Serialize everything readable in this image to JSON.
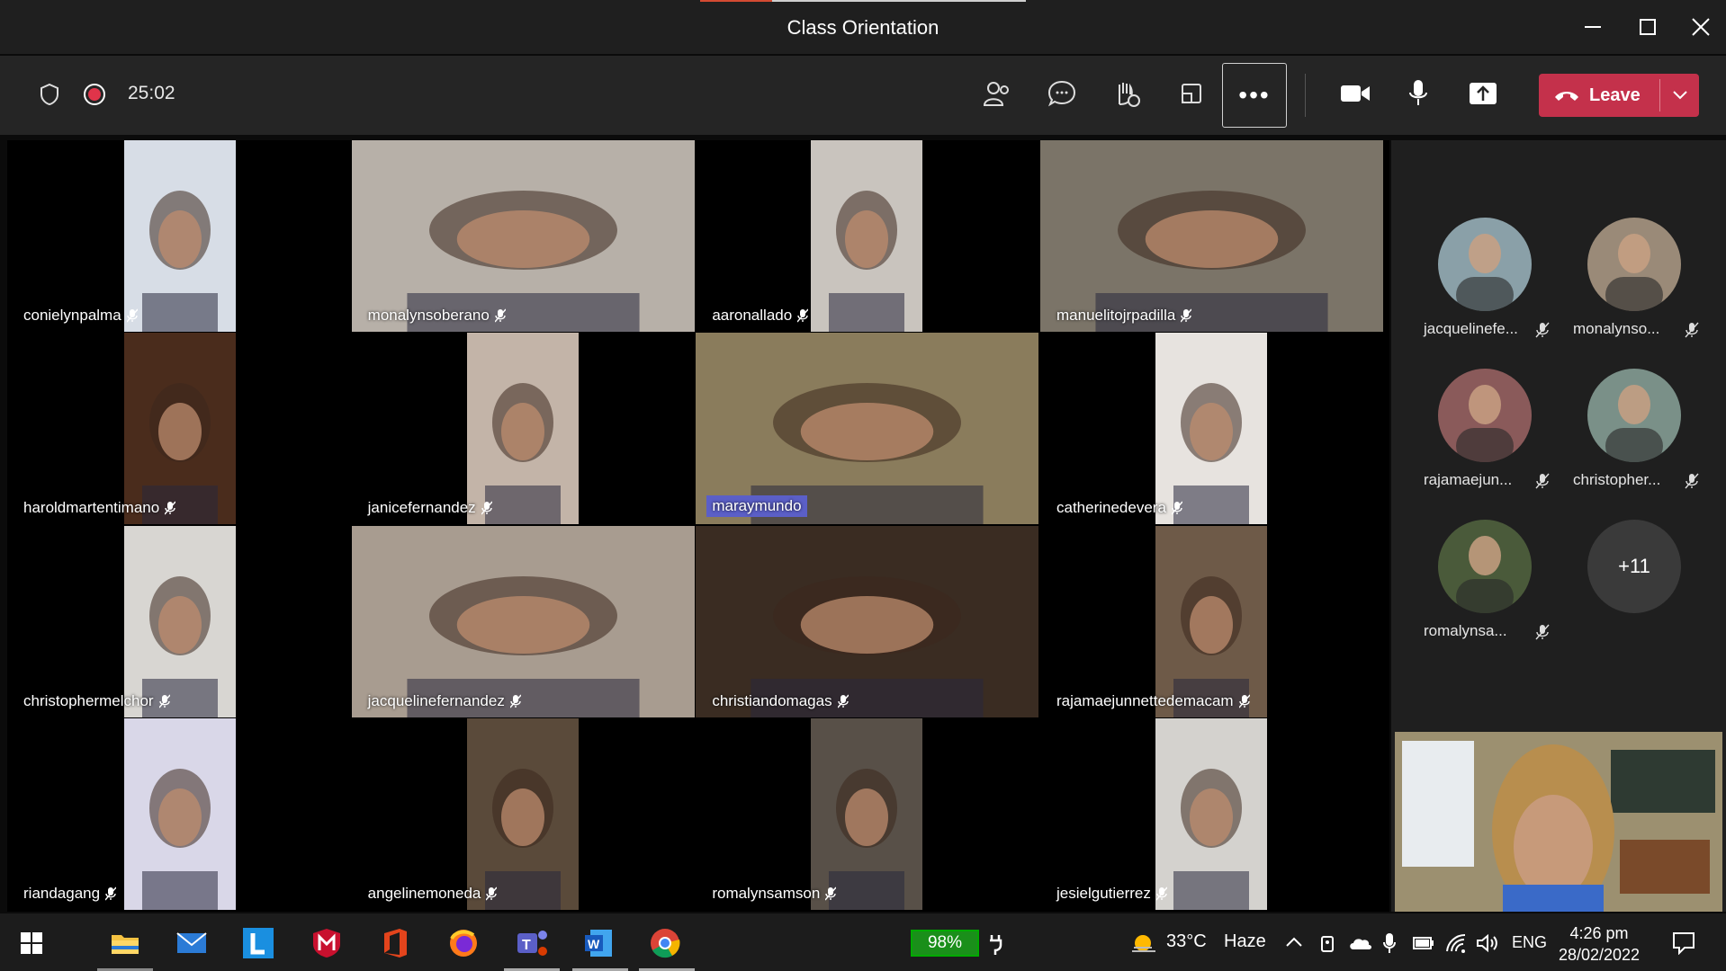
{
  "window": {
    "title": "Class Orientation"
  },
  "toolbar": {
    "timer": "25:02",
    "more_label": "•••",
    "leave_label": "Leave"
  },
  "grid": [
    {
      "name": "conielynpalma",
      "bg": "#d7dde6"
    },
    {
      "name": "monalynsoberano",
      "bg": "#b7b0a8"
    },
    {
      "name": "aaronallado",
      "bg": "#c9c4be"
    },
    {
      "name": "manuelitojrpadilla",
      "bg": "#7b7468"
    },
    {
      "name": "haroldmartentimano",
      "bg": "#4a2c1c"
    },
    {
      "name": "janicefernandez",
      "bg": "#c3b4a8"
    },
    {
      "name": "maraymundo",
      "bg": "#8a7c5c"
    },
    {
      "name": "catherinedevera",
      "bg": "#e7e3df"
    },
    {
      "name": "christophermelchor",
      "bg": "#d8d6d2"
    },
    {
      "name": "jacquelinefernandez",
      "bg": "#a89c90"
    },
    {
      "name": "christiandomagas",
      "bg": "#3a2c22"
    },
    {
      "name": "rajamaejunnettedemacam",
      "bg": "#6e5a48"
    },
    {
      "name": "riandagang",
      "bg": "#d9d7e8"
    },
    {
      "name": "angelinemoneda",
      "bg": "#5a4a3a"
    },
    {
      "name": "romalynsamson",
      "bg": "#585048"
    },
    {
      "name": "jesielgutierrez",
      "bg": "#d4d2ce"
    }
  ],
  "side": {
    "participants": [
      {
        "name": "jacquelinefe...",
        "bg": "#8aa0a8"
      },
      {
        "name": "monalynso...",
        "bg": "#9a8a78"
      },
      {
        "name": "rajamaejun...",
        "bg": "#8a5a5a"
      },
      {
        "name": "christopher...",
        "bg": "#7a9088"
      },
      {
        "name": "romalynsa...",
        "bg": "#4a5a3a"
      }
    ],
    "more_count": "+11"
  },
  "taskbar": {
    "battery": "98%",
    "weather": "33°C",
    "weather_desc": "Haze",
    "lang": "ENG",
    "time": "4:26 pm",
    "date": "28/02/2022"
  }
}
